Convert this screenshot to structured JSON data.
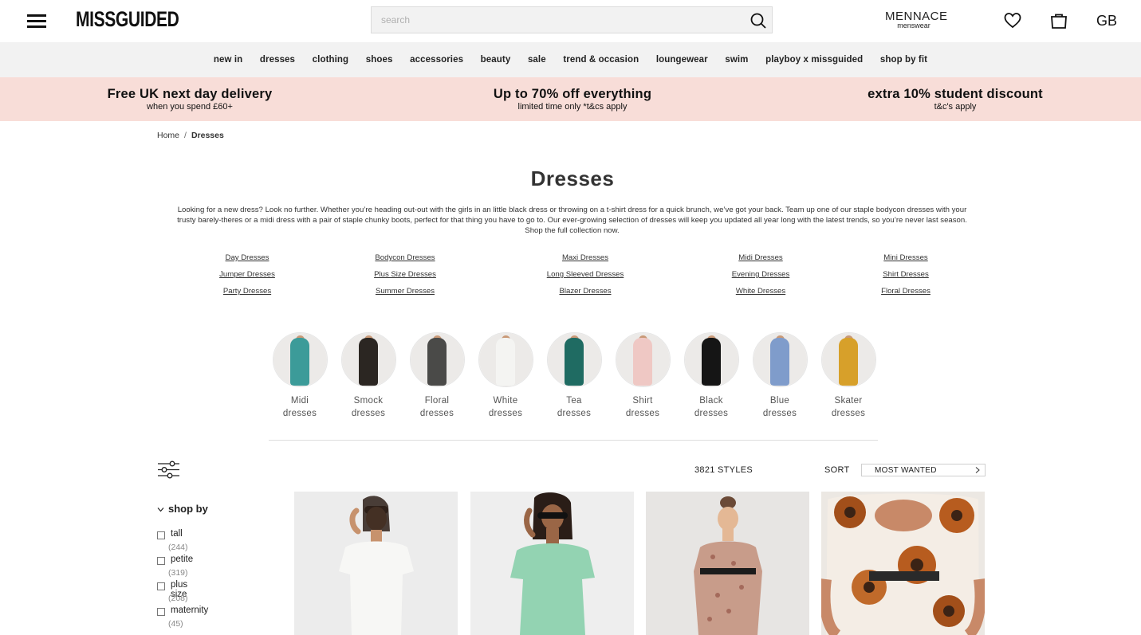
{
  "header": {
    "logo": "MISSGUIDED",
    "search_placeholder": "search",
    "mennace_title": "MENNACE",
    "mennace_sub": "menswear",
    "region": "GB"
  },
  "categories": [
    "new in",
    "dresses",
    "clothing",
    "shoes",
    "accessories",
    "beauty",
    "sale",
    "trend & occasion",
    "loungewear",
    "swim",
    "playboy x missguided",
    "shop by fit"
  ],
  "promos": [
    {
      "title": "Free UK next day delivery",
      "sub": "when you spend £60+"
    },
    {
      "title": "Up to 70% off everything",
      "sub": "limited time only *t&cs apply"
    },
    {
      "title": "extra 10% student discount",
      "sub": "t&c's apply"
    }
  ],
  "breadcrumb": {
    "home": "Home",
    "sep": "/",
    "current": "Dresses"
  },
  "page": {
    "title": "Dresses",
    "intro": "Looking for a new dress? Look no further. Whether you’re heading out-out with the girls in an little black dress or throwing on a t-shirt dress for a quick brunch, we’ve got your back. Team up one of our staple bodycon dresses with your trusty barely-theres or a midi dress with a pair of staple chunky boots, perfect for that thing you have to go to. Our ever-growing selection of dresses will keep you updated all year long with the latest trends, so you’re never last season. Shop the full collection now."
  },
  "sublinks": [
    [
      "Day Dresses",
      "Jumper Dresses",
      "Party Dresses"
    ],
    [
      "Bodycon Dresses",
      "Plus Size Dresses",
      "Summer Dresses"
    ],
    [
      "Maxi Dresses",
      "Long Sleeved Dresses",
      "Blazer Dresses"
    ],
    [
      "Midi Dresses",
      "Evening Dresses",
      "White Dresses"
    ],
    [
      "Mini Dresses",
      "Shirt Dresses",
      "Floral Dresses"
    ]
  ],
  "circles": [
    {
      "l1": "Midi",
      "l2": "dresses",
      "color": "#3c9b99"
    },
    {
      "l1": "Smock",
      "l2": "dresses",
      "color": "#2b2622"
    },
    {
      "l1": "Floral",
      "l2": "dresses",
      "color": "#4a4a48"
    },
    {
      "l1": "White",
      "l2": "dresses",
      "color": "#f4f4f2"
    },
    {
      "l1": "Tea",
      "l2": "dresses",
      "color": "#1f6b62"
    },
    {
      "l1": "Shirt",
      "l2": "dresses",
      "color": "#efc8c4"
    },
    {
      "l1": "Black",
      "l2": "dresses",
      "color": "#151515"
    },
    {
      "l1": "Blue",
      "l2": "dresses",
      "color": "#7f9ccb"
    },
    {
      "l1": "Skater",
      "l2": "dresses",
      "color": "#d7a02a"
    }
  ],
  "toolbar": {
    "styles": "3821 STYLES",
    "sort_label": "SORT",
    "sort_value": "MOST WANTED"
  },
  "shop_by": {
    "title": "shop by",
    "items": [
      {
        "name": "tall",
        "count": "(244)"
      },
      {
        "name": "petite",
        "count": "(319)"
      },
      {
        "name": "plus size",
        "count": "(208)"
      },
      {
        "name": "maternity",
        "count": "(45)"
      }
    ]
  },
  "products": [
    {
      "dress_color": "#f7f7f5",
      "bg": "#ececec"
    },
    {
      "dress_color": "#93d3b2",
      "bg": "#eeeeee"
    },
    {
      "dress_color": "#c89c8a",
      "bg": "#e7e5e3"
    },
    {
      "dress_color": "#f4ede5",
      "bg": "#ece8e3"
    }
  ]
}
